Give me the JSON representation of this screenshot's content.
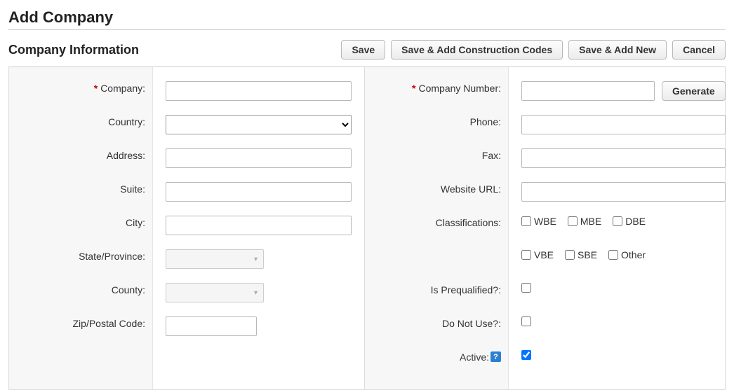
{
  "page": {
    "title": "Add Company",
    "section": "Company Information"
  },
  "buttons": {
    "save": "Save",
    "save_codes": "Save & Add Construction Codes",
    "save_new": "Save & Add New",
    "cancel": "Cancel",
    "generate": "Generate"
  },
  "left": {
    "company": "Company:",
    "country": "Country:",
    "address": "Address:",
    "suite": "Suite:",
    "city": "City:",
    "state": "State/Province:",
    "county": "County:",
    "zip": "Zip/Postal Code:"
  },
  "right": {
    "company_number": "Company Number:",
    "phone": "Phone:",
    "fax": "Fax:",
    "url": "Website URL:",
    "classifications": "Classifications:",
    "prequalified": "Is Prequalified?:",
    "donotuse": "Do Not Use?:",
    "active": "Active:"
  },
  "classifications": {
    "wbe": "WBE",
    "mbe": "MBE",
    "dbe": "DBE",
    "vbe": "VBE",
    "sbe": "SBE",
    "other": "Other"
  },
  "values": {
    "company": "",
    "country": "",
    "address": "",
    "suite": "",
    "city": "",
    "state": "",
    "county": "",
    "zip": "",
    "company_number": "",
    "phone": "",
    "fax": "",
    "url": "",
    "wbe": false,
    "mbe": false,
    "dbe": false,
    "vbe": false,
    "sbe": false,
    "other": false,
    "prequalified": false,
    "donotuse": false,
    "active": true
  },
  "required_marker": "*",
  "help": "?"
}
